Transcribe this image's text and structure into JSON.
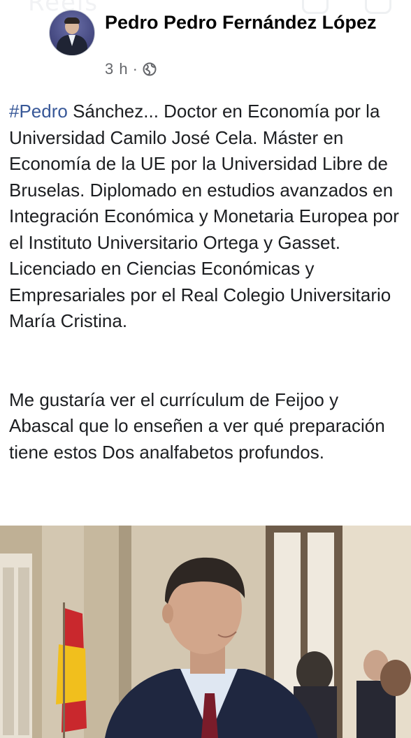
{
  "header": {
    "author_name": "Pedro Pedro Fernández López",
    "timestamp": "3 h",
    "separator": "·",
    "audience_icon": "globe-icon"
  },
  "post": {
    "hashtag": "#Pedro",
    "paragraph1_rest": " Sánchez... Doctor en Economía por la Universidad Camilo José Cela. Máster en Economía de la UE por la Universidad Libre de Bruselas. Diplomado en estudios avanzados en Integración Económica y Monetaria Europea por el Instituto Universitario Ortega y Gasset. Licenciado en Ciencias Económicas y Empresariales por el Real Colegio Universitario María Cristina.",
    "paragraph2": "Me gustaría ver el currículum de Feijoo y Abascal que lo enseñen a ver qué preparación tiene estos Dos analfabetos profundos."
  },
  "colors": {
    "hashtag": "#385898",
    "text": "#1c1e21",
    "meta": "#65676b"
  }
}
